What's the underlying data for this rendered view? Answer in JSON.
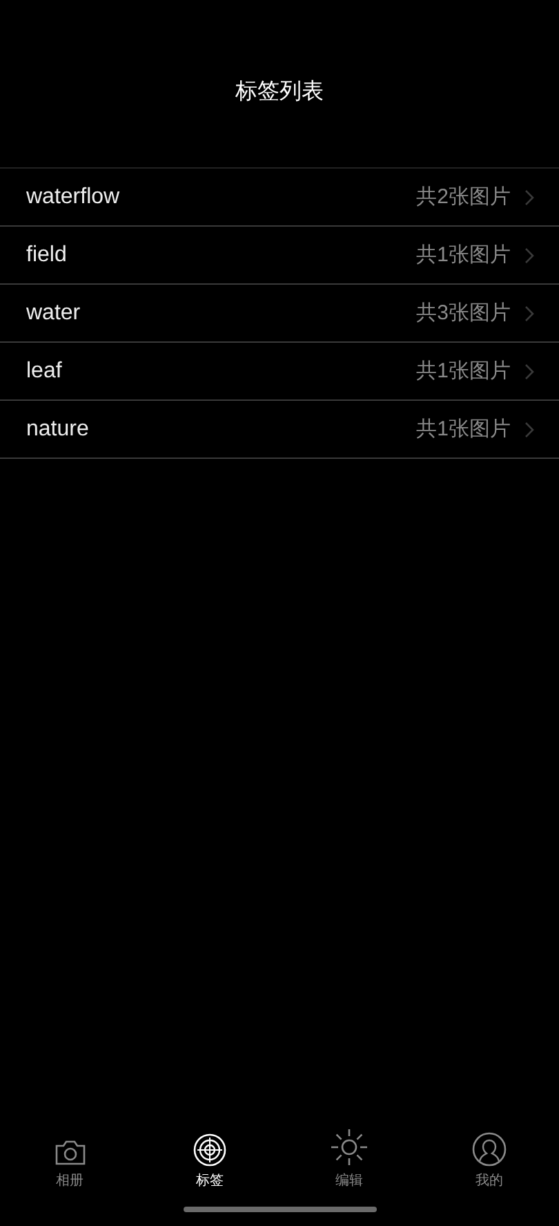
{
  "header": {
    "title": "标签列表"
  },
  "tags": [
    {
      "name": "waterflow",
      "count": "共2张图片"
    },
    {
      "name": "field",
      "count": "共1张图片"
    },
    {
      "name": "water",
      "count": "共3张图片"
    },
    {
      "name": "leaf",
      "count": "共1张图片"
    },
    {
      "name": "nature",
      "count": "共1张图片"
    }
  ],
  "tab_bar": [
    {
      "kind": "camera",
      "label": "相册",
      "selected": false
    },
    {
      "kind": "target",
      "label": "标签",
      "selected": true
    },
    {
      "kind": "sun",
      "label": "编辑",
      "selected": false
    },
    {
      "kind": "person",
      "label": "我的",
      "selected": false
    }
  ]
}
